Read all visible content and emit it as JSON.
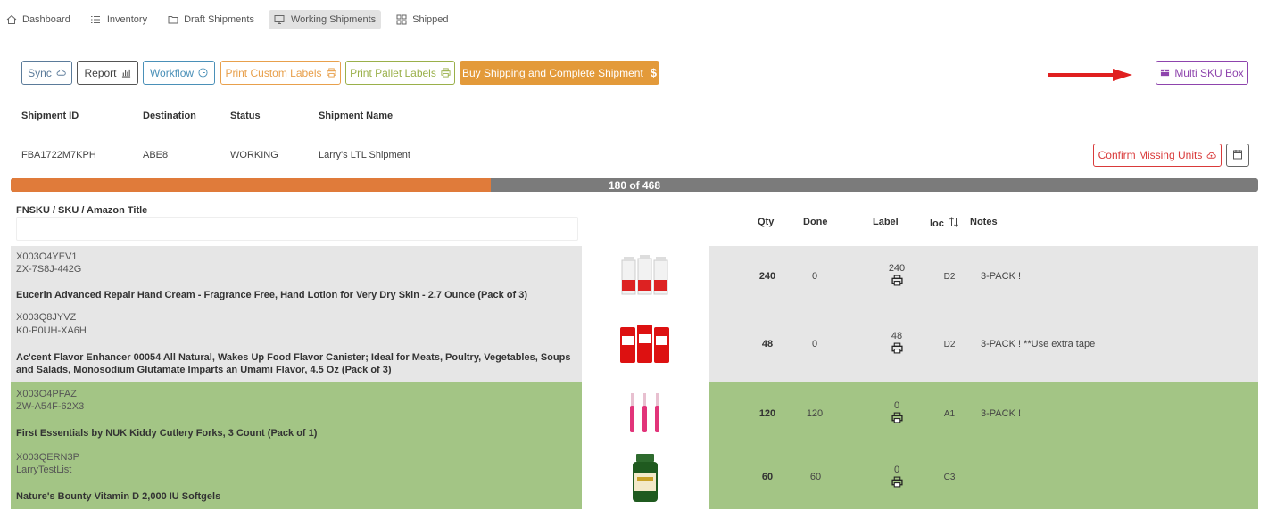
{
  "nav": {
    "items": [
      {
        "label": "Dashboard",
        "icon": "home-icon"
      },
      {
        "label": "Inventory",
        "icon": "list-icon"
      },
      {
        "label": "Draft Shipments",
        "icon": "folder-icon"
      },
      {
        "label": "Working Shipments",
        "icon": "monitor-icon",
        "active": true
      },
      {
        "label": "Shipped",
        "icon": "grid-icon"
      }
    ]
  },
  "toolbar": {
    "sync": "Sync",
    "report": "Report",
    "workflow": "Workflow",
    "print_custom": "Print Custom Labels",
    "print_pallet": "Print Pallet Labels",
    "buy_shipping": "Buy Shipping and Complete Shipment",
    "buy_symbol": "$",
    "multi_sku": "Multi SKU Box"
  },
  "colors": {
    "slate": "#5b7b9a",
    "steel": "#4a90b8",
    "orange": "#e8a04c",
    "olive": "#9ab04a",
    "amber": "#e39a3a",
    "purple": "#8e44ad",
    "red": "#d93a3a",
    "progress": "#e07b3a",
    "green_row": "#a3c585",
    "grey_row": "#e6e6e6"
  },
  "shipment": {
    "headers": {
      "id": "Shipment ID",
      "destination": "Destination",
      "status": "Status",
      "name": "Shipment Name"
    },
    "id": "FBA1722M7KPH",
    "destination": "ABE8",
    "status": "WORKING",
    "name": "Larry's LTL Shipment",
    "confirm_missing": "Confirm Missing Units"
  },
  "progress": {
    "done": 180,
    "total": 468,
    "label": "180 of 468"
  },
  "table": {
    "headers": {
      "fnsku": "FNSKU / SKU / Amazon Title",
      "qty": "Qty",
      "done": "Done",
      "label": "Label",
      "loc": "loc",
      "notes": "Notes"
    },
    "filter_value": "",
    "rows": [
      {
        "fnsku": "X003O4YEV1",
        "sku": "ZX-7S8J-442G",
        "title": "Eucerin Advanced Repair Hand Cream - Fragrance Free, Hand Lotion for Very Dry Skin - 2.7 Ounce (Pack of 3)",
        "qty": "240",
        "done": "0",
        "label": "240",
        "loc": "D2",
        "notes": "3-PACK !",
        "state": "grey",
        "image": "hand-cream-tubes"
      },
      {
        "fnsku": "X003Q8JYVZ",
        "sku": "K0-P0UH-XA6H",
        "title": "Ac'cent Flavor Enhancer 00054 All Natural, Wakes Up Food Flavor Canister; Ideal for Meats, Poultry, Vegetables, Soups and Salads, Monosodium Glutamate Imparts an Umami Flavor, 4.5 Oz (Pack of 3)",
        "qty": "48",
        "done": "0",
        "label": "48",
        "loc": "D2",
        "notes": "3-PACK ! **Use extra tape",
        "state": "grey",
        "image": "red-canisters"
      },
      {
        "fnsku": "X003O4PFAZ",
        "sku": "ZW-A54F-62X3",
        "title": "First Essentials by NUK Kiddy Cutlery Forks, 3 Count (Pack of 1)",
        "qty": "120",
        "done": "120",
        "label": "0",
        "loc": "A1",
        "notes": "3-PACK !",
        "state": "green",
        "image": "pink-forks"
      },
      {
        "fnsku": "X003QERN3P",
        "sku": "LarryTestList",
        "title": "Nature's Bounty Vitamin D 2,000 IU Softgels",
        "qty": "60",
        "done": "60",
        "label": "0",
        "loc": "C3",
        "notes": "",
        "state": "green",
        "image": "vitamin-bottle"
      }
    ]
  }
}
